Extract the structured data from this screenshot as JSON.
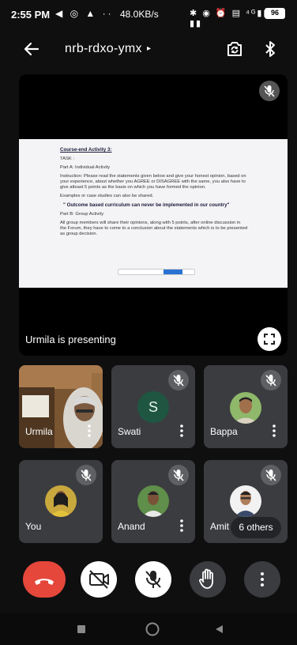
{
  "status_bar": {
    "time": "2:55 PM",
    "left_icons": "◀ ◎ ▲ ··",
    "network_speed": "48.0KB/s",
    "right_icons": "✱ ◉ ⏰ ▤ ⁴ᴳ▮▮ ▤ ▮▮",
    "battery": "96"
  },
  "header": {
    "meeting_code": "nrb-rdxo-ymx",
    "caret": "▸"
  },
  "presentation": {
    "doc_title": "Course-end Activity 3:",
    "task_label": "TASK :",
    "part_a": "Part A: Individual Activity",
    "instruction": "Instruction: Please read the statements given below and give your honest opinion, based on your experience, about whether you AGREE or DISAGREE with the same, you also have to give atleast 5 points as the basis on which you have formed the opinion.",
    "examples": "Examples or case studies can also be shared.",
    "quote": "\" Outcome based curriculum can never be implemented in our country\"",
    "part_b": "Part B: Group Activity",
    "group_text": "All group members will share their opinions, along with 5 points, after online discussion in the Forum, they have to come to a conclusion about the statements which is to be presented as group decision.",
    "presenter_label": "Urmila is presenting"
  },
  "participants": [
    {
      "name": "Urmila",
      "type": "video"
    },
    {
      "name": "Swati",
      "type": "letter",
      "initial": "S"
    },
    {
      "name": "Bappa",
      "type": "photo"
    },
    {
      "name": "You",
      "type": "photo"
    },
    {
      "name": "Anand",
      "type": "photo"
    },
    {
      "name": "Amit",
      "type": "photo"
    }
  ],
  "others_label": "6 others",
  "colors": {
    "end_call": "#e5473b",
    "tile_bg": "#3b3c40",
    "swati_avatar": "#1f5641"
  }
}
